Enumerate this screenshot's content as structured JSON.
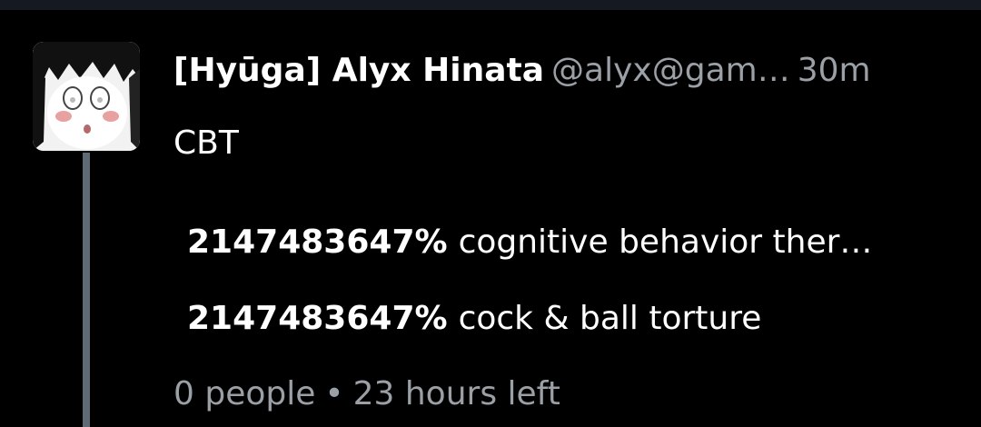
{
  "post": {
    "display_name": "[Hyūga] Alyx Hinata",
    "handle": "@alyx@gam…",
    "time": "30m",
    "content": "CBT",
    "avatar_icon": "anime-girl-avatar-icon"
  },
  "poll": {
    "options": [
      {
        "percent": "2147483647%",
        "label": "cognitive behavior ther…"
      },
      {
        "percent": "2147483647%",
        "label": "cock & ball torture"
      }
    ],
    "voters": "0 people",
    "separator": "•",
    "time_left": "23 hours left"
  },
  "colors": {
    "background": "#000000",
    "text": "#ffffff",
    "muted": "#9aa0a6",
    "thread_line": "#606a74",
    "top_bar": "#151a22"
  }
}
